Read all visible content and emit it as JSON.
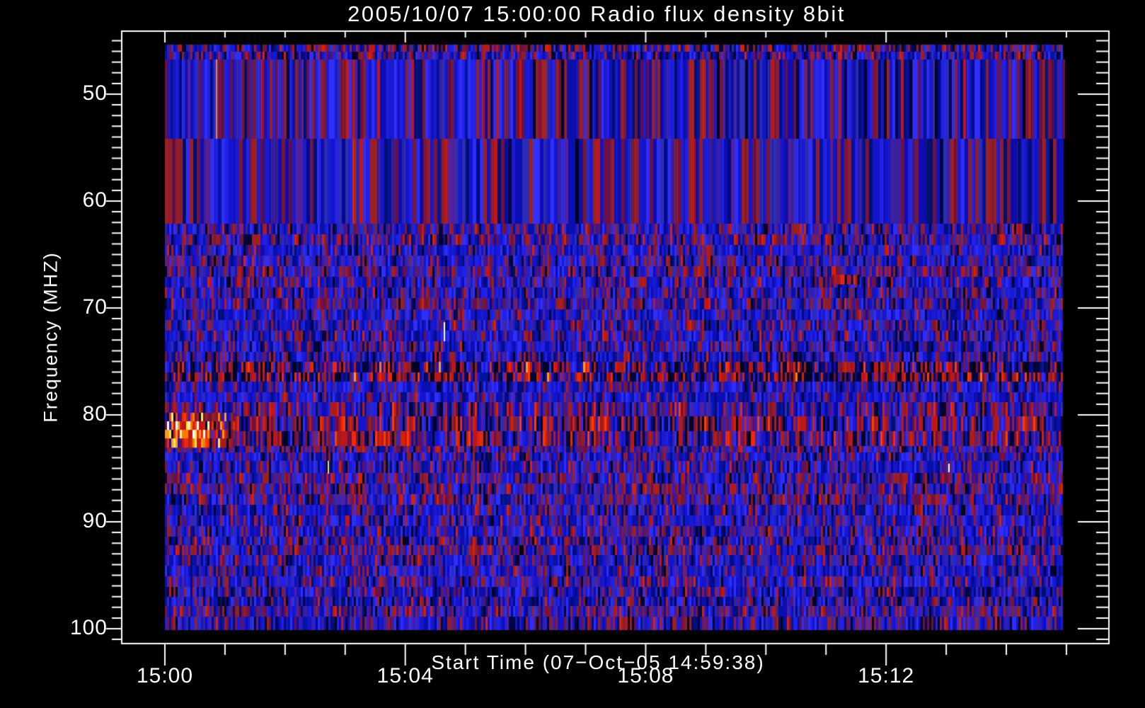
{
  "window": {
    "background": "#000000",
    "text_color": "#ffffff"
  },
  "chart_data": {
    "type": "heatmap",
    "title": "2005/10/07 15:00:00 Radio flux density 8bit",
    "xlabel": "Start Time (07−Oct−05 14:59:38)",
    "ylabel": "Frequency (MHZ)",
    "colormap": "8-bit intensity: dark/blue (weak) → dark red → red → orange → yellow → white (strong)",
    "x_unit": "UT time, minutes after 15:00",
    "x_span_min": 14.95,
    "x_major_ticks": [
      {
        "label": "15:00",
        "min": 0
      },
      {
        "label": "15:04",
        "min": 4
      },
      {
        "label": "15:08",
        "min": 8
      },
      {
        "label": "15:12",
        "min": 12
      }
    ],
    "x_minor_tick_every_min": 1,
    "y_major_ticks": [
      "50",
      "60",
      "70",
      "80",
      "90",
      "100"
    ],
    "y_major_tick_values_mhz": [
      50,
      60,
      70,
      80,
      90,
      100
    ],
    "y_minor_tick_every_mhz": 1,
    "y_data_range_mhz": [
      45.35,
      100.1
    ],
    "y_inverted": true,
    "legend": "none",
    "grid": "off",
    "notes": "Solar radio spectrogram: noisy blue background with quasi-periodic red interference/burst bands near 75–77 MHz and 79–83 MHz across the whole interval; brightest burst (orange/yellow/white) at 15:00:00–15:01:10 around 80–83 MHz; broad striped bands 47–62 MHz; isolated narrowband spikes listed in features.",
    "palette": {
      "blue": [
        "#1414cc",
        "#2020e6",
        "#2e2ef8",
        "#0d0db4",
        "#1a1ad0"
      ],
      "deep": [
        "#000a8c",
        "#0414a0",
        "#001070"
      ],
      "dark": [
        "#00031c",
        "#000540",
        "#02002a"
      ],
      "purple": [
        "#3a1f9e",
        "#51209a",
        "#2c2cb4"
      ],
      "dred": [
        "#7c1535",
        "#8e1d2d",
        "#6a1048",
        "#9c2020"
      ],
      "red": [
        "#c41414",
        "#d32306",
        "#b81a1a"
      ],
      "bred": [
        "#f32800",
        "#ff3c00",
        "#e82810"
      ],
      "orange": [
        "#ff7b00",
        "#ff9a1e"
      ],
      "yellow": [
        "#ffe84a",
        "#fff2a0"
      ],
      "white": [
        "#ffffff"
      ]
    },
    "bands": [
      {
        "f0": 45.35,
        "f1": 46.05,
        "col_s": 2.1,
        "w": {
          "blue": 4,
          "deep": 2,
          "dark": 1.5,
          "dred": 3,
          "red": 1.2,
          "purple": 1
        }
      },
      {
        "f0": 46.05,
        "f1": 46.75,
        "col_s": 2.1,
        "w": {
          "blue": 5,
          "deep": 2,
          "dark": 1,
          "dred": 2,
          "red": 0.8,
          "purple": 1
        }
      },
      {
        "f0": 46.75,
        "f1": 54.2,
        "col_s": 2.8,
        "overlay": true,
        "w": {
          "blue": 6,
          "deep": 1.6,
          "dark": 0.5,
          "dred": 3.2,
          "red": 0.45,
          "purple": 1.2
        }
      },
      {
        "f0": 54.2,
        "f1": 62.1,
        "col_s": 3.5,
        "overlay": true,
        "w": {
          "blue": 6,
          "deep": 1.4,
          "dark": 0.4,
          "dred": 2.6,
          "red": 0.35,
          "purple": 2.2
        }
      },
      {
        "f0": 62.1,
        "f1": 63.1,
        "col_s": 2.1,
        "w": {
          "blue": 5,
          "deep": 1.5,
          "dark": 0.8,
          "dred": 2.2,
          "red": 0.5,
          "purple": 1.5
        }
      },
      {
        "f0": 63.1,
        "f1": 64.1,
        "col_s": 2.1,
        "w": {
          "blue": 4.5,
          "deep": 1.2,
          "dark": 0.6,
          "dred": 2.8,
          "red": 0.9,
          "purple": 1.6
        }
      },
      {
        "f0": 64.1,
        "f1": 65.1,
        "col_s": 2.1,
        "w": {
          "blue": 6,
          "deep": 1.5,
          "dark": 0.5,
          "dred": 1.6,
          "red": 0.3,
          "purple": 1.2
        }
      },
      {
        "f0": 65.1,
        "f1": 66.1,
        "col_s": 2.1,
        "w": {
          "blue": 5,
          "deep": 1.2,
          "dark": 0.6,
          "dred": 2.2,
          "red": 0.5,
          "purple": 1.8
        }
      },
      {
        "f0": 66.1,
        "f1": 67.1,
        "col_s": 2.1,
        "w": {
          "blue": 4,
          "deep": 1,
          "dark": 0.6,
          "dred": 3,
          "red": 0.8,
          "purple": 2
        }
      },
      {
        "f0": 67.1,
        "f1": 68.1,
        "col_s": 2.1,
        "w": {
          "blue": 5.5,
          "deep": 1.3,
          "dark": 0.5,
          "dred": 1.8,
          "red": 0.5,
          "purple": 1.4
        }
      },
      {
        "f0": 68.1,
        "f1": 69.1,
        "col_s": 2.1,
        "w": {
          "blue": 5,
          "deep": 1.4,
          "dark": 0.6,
          "dred": 2.2,
          "red": 0.5,
          "purple": 1.6
        }
      },
      {
        "f0": 69.1,
        "f1": 70.1,
        "col_s": 2.1,
        "w": {
          "blue": 4.2,
          "deep": 1.2,
          "dark": 0.6,
          "dred": 2.8,
          "red": 0.7,
          "purple": 2
        }
      },
      {
        "f0": 70.1,
        "f1": 71.1,
        "col_s": 2.1,
        "w": {
          "blue": 6,
          "deep": 1.4,
          "dark": 0.5,
          "dred": 1.5,
          "red": 0.3,
          "purple": 1.2
        }
      },
      {
        "f0": 71.1,
        "f1": 72.1,
        "col_s": 2.1,
        "w": {
          "blue": 4.6,
          "deep": 1.2,
          "dark": 0.6,
          "dred": 2.4,
          "red": 0.6,
          "purple": 2
        }
      },
      {
        "f0": 72.1,
        "f1": 73.1,
        "col_s": 2.1,
        "w": {
          "blue": 6,
          "deep": 1.5,
          "dark": 0.5,
          "dred": 1.6,
          "red": 0.35,
          "purple": 1.2
        }
      },
      {
        "f0": 73.1,
        "f1": 74.1,
        "col_s": 2.1,
        "w": {
          "blue": 5,
          "deep": 1.5,
          "dark": 0.7,
          "dred": 2,
          "red": 0.5,
          "purple": 1.6
        }
      },
      {
        "f0": 74.1,
        "f1": 75.0,
        "col_s": 2.1,
        "w": {
          "blue": 5.5,
          "deep": 1.8,
          "dark": 0.8,
          "dred": 1.6,
          "red": 0.35,
          "purple": 1.2
        }
      },
      {
        "f0": 75.0,
        "f1": 76.0,
        "col_s": 2.1,
        "redmod": {
          "period_s": 68,
          "amp": 2.2,
          "phase_min": 0
        },
        "w": {
          "blue": 2.2,
          "deep": 1.8,
          "dark": 3.2,
          "dred": 1.6,
          "red": 1.6,
          "bred": 0.5,
          "orange": 0.12
        }
      },
      {
        "f0": 76.0,
        "f1": 76.9,
        "col_s": 2.1,
        "redmod": {
          "period_s": 68,
          "amp": 2.8,
          "phase_min": 0.1
        },
        "w": {
          "blue": 1.8,
          "deep": 1.6,
          "dark": 3.6,
          "dred": 1.8,
          "red": 2,
          "bred": 0.8,
          "orange": 0.18
        }
      },
      {
        "f0": 76.9,
        "f1": 77.9,
        "col_s": 2.1,
        "w": {
          "blue": 6,
          "deep": 1.6,
          "dark": 0.6,
          "dred": 1.5,
          "red": 0.3,
          "purple": 1.1
        }
      },
      {
        "f0": 77.9,
        "f1": 78.8,
        "col_s": 2.1,
        "w": {
          "blue": 6.5,
          "deep": 1.4,
          "dark": 0.4,
          "dred": 1.2,
          "red": 0.25,
          "purple": 1
        }
      },
      {
        "f0": 78.8,
        "f1": 80.1,
        "col_s": 2.1,
        "redmod": {
          "period_s": 68,
          "amp": 2.4,
          "phase_min": 0.2
        },
        "w": {
          "blue": 4,
          "deep": 1.2,
          "dark": 0.8,
          "dred": 2.6,
          "red": 1,
          "purple": 1.4
        }
      },
      {
        "f0": 80.1,
        "f1": 81.5,
        "col_s": 2.1,
        "redmod": {
          "period_s": 68,
          "amp": 3.6,
          "phase_min": 0.25
        },
        "w": {
          "blue": 3,
          "deep": 1,
          "dark": 1.2,
          "dred": 2.6,
          "red": 1.8,
          "bred": 0.5,
          "purple": 1
        }
      },
      {
        "f0": 81.5,
        "f1": 82.9,
        "col_s": 2.1,
        "redmod": {
          "period_s": 68,
          "amp": 3,
          "phase_min": 0.3
        },
        "w": {
          "blue": 3.2,
          "deep": 1.1,
          "dark": 1.4,
          "dred": 2.6,
          "red": 1.5,
          "bred": 0.4,
          "purple": 1
        }
      },
      {
        "f0": 82.9,
        "f1": 83.5,
        "col_s": 2.1,
        "w": {
          "blue": 3.6,
          "deep": 1.2,
          "dark": 0.8,
          "dred": 3,
          "red": 1.1,
          "purple": 1.6
        }
      },
      {
        "f0": 83.5,
        "f1": 84.3,
        "col_s": 2.1,
        "w": {
          "blue": 6,
          "deep": 1.5,
          "dark": 0.5,
          "dred": 1.6,
          "red": 0.35,
          "purple": 1.2
        }
      },
      {
        "f0": 84.3,
        "f1": 85.4,
        "col_s": 2.1,
        "w": {
          "blue": 5.5,
          "deep": 1.4,
          "dark": 0.6,
          "dred": 1.8,
          "red": 0.45,
          "purple": 1.4
        }
      },
      {
        "f0": 85.4,
        "f1": 86.4,
        "col_s": 2.1,
        "w": {
          "blue": 4.5,
          "deep": 1.2,
          "dark": 0.6,
          "dred": 2.4,
          "red": 0.7,
          "purple": 1.8
        }
      },
      {
        "f0": 86.4,
        "f1": 87.4,
        "col_s": 2.1,
        "w": {
          "blue": 3.6,
          "deep": 1,
          "dark": 0.7,
          "dred": 3.2,
          "red": 1,
          "purple": 2.2
        }
      },
      {
        "f0": 87.4,
        "f1": 88.4,
        "col_s": 2.1,
        "w": {
          "blue": 4.2,
          "deep": 1.1,
          "dark": 0.6,
          "dred": 2.8,
          "red": 0.8,
          "purple": 2
        }
      },
      {
        "f0": 88.4,
        "f1": 89.4,
        "col_s": 2.1,
        "w": {
          "blue": 6,
          "deep": 1.5,
          "dark": 0.5,
          "dred": 1.5,
          "red": 0.3,
          "purple": 1.2
        }
      },
      {
        "f0": 89.4,
        "f1": 90.4,
        "col_s": 2.1,
        "w": {
          "blue": 6,
          "deep": 1.4,
          "dark": 0.5,
          "dred": 1.6,
          "red": 0.35,
          "purple": 1.3
        }
      },
      {
        "f0": 90.4,
        "f1": 91.4,
        "col_s": 2.1,
        "w": {
          "blue": 5,
          "deep": 1.3,
          "dark": 0.6,
          "dred": 2.2,
          "red": 0.6,
          "purple": 1.6
        }
      },
      {
        "f0": 91.4,
        "f1": 92.2,
        "col_s": 2.1,
        "w": {
          "blue": 4.4,
          "deep": 1.6,
          "dark": 1,
          "dred": 2.2,
          "red": 0.5,
          "purple": 1.6
        }
      },
      {
        "f0": 92.2,
        "f1": 93.1,
        "col_s": 2.1,
        "w": {
          "blue": 3.2,
          "deep": 1,
          "dark": 0.7,
          "dred": 3.4,
          "red": 1.2,
          "purple": 2.4
        }
      },
      {
        "f0": 93.1,
        "f1": 94.1,
        "col_s": 2.1,
        "w": {
          "blue": 5,
          "deep": 1.3,
          "dark": 0.6,
          "dred": 2,
          "red": 0.5,
          "purple": 1.7
        }
      },
      {
        "f0": 94.1,
        "f1": 95.1,
        "col_s": 2.1,
        "w": {
          "blue": 6,
          "deep": 1.4,
          "dark": 0.5,
          "dred": 1.5,
          "red": 0.3,
          "purple": 1.2
        }
      },
      {
        "f0": 95.1,
        "f1": 96.1,
        "col_s": 2.1,
        "w": {
          "blue": 5,
          "deep": 1.3,
          "dark": 0.6,
          "dred": 2.1,
          "red": 0.5,
          "purple": 1.7
        }
      },
      {
        "f0": 96.1,
        "f1": 97.0,
        "col_s": 2.1,
        "w": {
          "blue": 5.5,
          "deep": 1.8,
          "dark": 0.9,
          "dred": 1.6,
          "red": 0.3,
          "purple": 1.3
        }
      },
      {
        "f0": 97.0,
        "f1": 97.9,
        "col_s": 2.1,
        "w": {
          "blue": 4.6,
          "deep": 2,
          "dark": 1.2,
          "dred": 1.8,
          "red": 0.35,
          "purple": 1.5
        }
      },
      {
        "f0": 97.9,
        "f1": 98.9,
        "col_s": 2.1,
        "w": {
          "blue": 4,
          "deep": 1.2,
          "dark": 0.6,
          "dred": 2.8,
          "red": 0.8,
          "purple": 2
        }
      },
      {
        "f0": 98.9,
        "f1": 100.1,
        "col_s": 2.1,
        "w": {
          "blue": 5,
          "deep": 1.5,
          "dark": 0.8,
          "dred": 2.2,
          "red": 0.5,
          "purple": 1.4
        }
      }
    ],
    "features": [
      {
        "type": "blob",
        "t0_min": 0.0,
        "t1_min": 1.15,
        "t_core_min": 0.35,
        "f0": 79.8,
        "f1": 83.0,
        "desc": "bright burst, yellow/white core near 15:00:21 at 80–82 MHz"
      },
      {
        "type": "vline",
        "t_min": 0.85,
        "f0": 46.75,
        "f1": 54.2,
        "w_s": 1.4,
        "color": "#ff8413",
        "desc": "orange spike ~15:00:51, 47–54 MHz"
      },
      {
        "type": "vline",
        "t_min": 4.64,
        "f0": 71.3,
        "f1": 73.1,
        "w_s": 1.4,
        "color": "#fffbe0",
        "desc": "white spike ~15:04:38, ~72 MHz"
      },
      {
        "type": "vline",
        "t_min": 2.71,
        "f0": 84.3,
        "f1": 85.5,
        "w_s": 1.4,
        "color": "#ffd94a",
        "desc": "yellow spike ~15:02:43, ~85 MHz"
      },
      {
        "type": "vline",
        "t_min": 13.03,
        "f0": 84.6,
        "f1": 85.4,
        "w_s": 1.4,
        "color": "#ffffff",
        "desc": "white speck ~15:13:02, ~85 MHz"
      },
      {
        "type": "patch",
        "t0_min": 11.1,
        "t1_min": 11.55,
        "f0": 66.9,
        "f1": 67.8,
        "desc": "red/orange enhancement 15:11:06–15:11:33 near 67 MHz"
      }
    ]
  }
}
